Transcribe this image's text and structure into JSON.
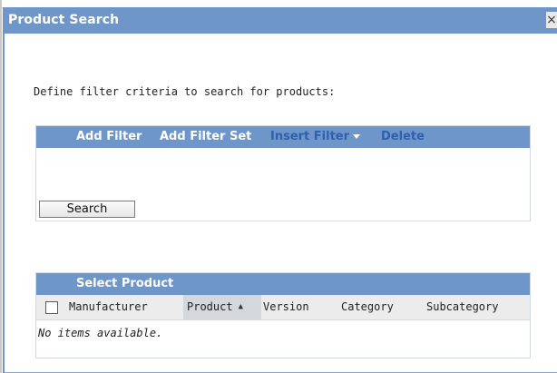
{
  "dialog": {
    "title": "Product Search",
    "close_glyph": "×",
    "instructions": "Define filter criteria to search for products:"
  },
  "filter_toolbar": {
    "add_filter": "Add Filter",
    "add_filter_set": "Add Filter Set",
    "insert_filter": "Insert Filter",
    "delete": "Delete"
  },
  "search_button": "Search",
  "results": {
    "title": "Select Product",
    "columns": [
      "Manufacturer",
      "Product",
      "Version",
      "Category",
      "Subcategory"
    ],
    "sorted_column": "Product",
    "sort_direction": "ascending",
    "empty_message": "No items available."
  },
  "icons": {
    "close": "close-icon",
    "dropdown": "chevron-down-icon",
    "sort": "sort-ascending-icon"
  },
  "colors": {
    "header_blue": "#6f96c9",
    "link_blue": "#2f5fae",
    "column_header_bg": "#ececec",
    "sorted_column_bg": "#d4d8dc"
  }
}
